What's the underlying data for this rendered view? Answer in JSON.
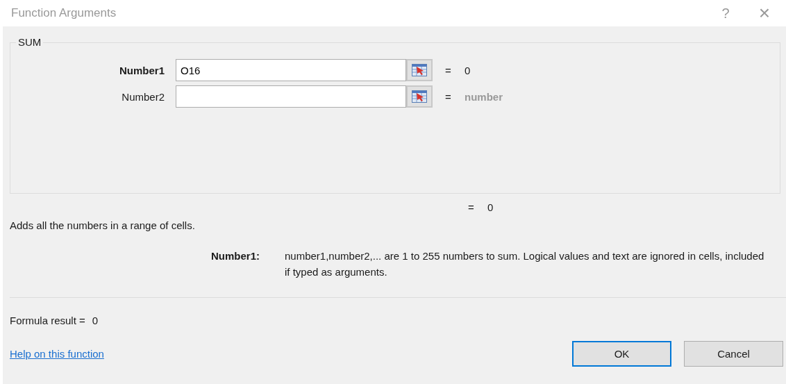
{
  "window": {
    "title": "Function Arguments",
    "help_glyph": "?",
    "close_glyph": "×"
  },
  "function": {
    "name": "SUM",
    "arguments": [
      {
        "label": "Number1",
        "required": true,
        "value": "O16",
        "result": "=",
        "result_value": "0",
        "dimmed": false
      },
      {
        "label": "Number2",
        "required": false,
        "result": "=",
        "result_value": "number",
        "dimmed": true
      }
    ]
  },
  "result": {
    "equals": "=",
    "value": "0"
  },
  "description": "Adds all the numbers in a range of cells.",
  "argument_help": {
    "label": "Number1:",
    "text": "number1,number2,... are 1 to 255 numbers to sum. Logical values and text are ignored in cells, included if typed as arguments."
  },
  "formula_result": {
    "label": "Formula result =",
    "value": "0"
  },
  "help_link": "Help on this function",
  "buttons": [
    {
      "label": "OK",
      "default": true
    },
    {
      "label": "Cancel",
      "default": false
    }
  ]
}
